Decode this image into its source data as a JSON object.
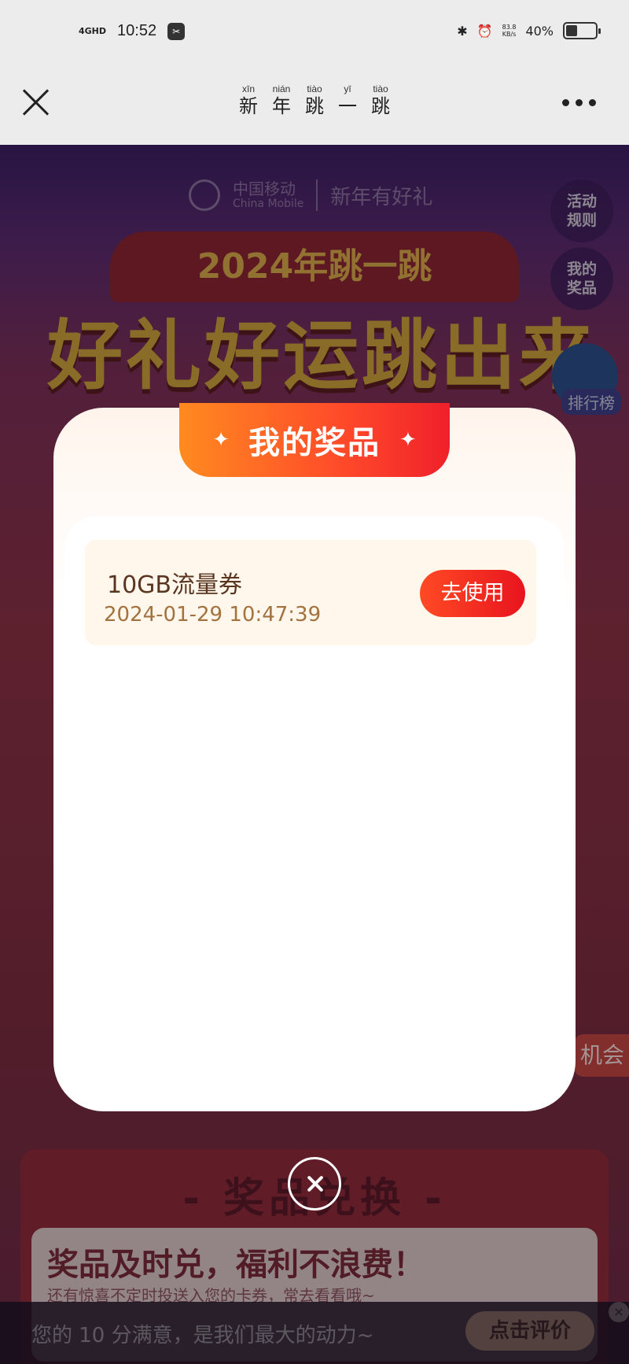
{
  "status_bar": {
    "signal": "4GHD",
    "time": "10:52",
    "net_speed_value": "83.8",
    "net_speed_unit": "KB/s",
    "battery": "40%",
    "battery_level": 0.4
  },
  "nav": {
    "title_chars": [
      {
        "pinyin": "xīn",
        "char": "新"
      },
      {
        "pinyin": "nián",
        "char": "年"
      },
      {
        "pinyin": "tiào",
        "char": "跳"
      },
      {
        "pinyin": "yī",
        "char": "一"
      },
      {
        "pinyin": "tiào",
        "char": "跳"
      }
    ]
  },
  "background": {
    "brand_name": "中国移动",
    "brand_sub": "China Mobile",
    "brand_slogan": "新年有好礼",
    "rules_btn": "活动规则",
    "my_prizes_btn": "我的奖品",
    "year_banner": "2024年跳一跳",
    "main_title": "好礼好运跳出来",
    "rank_label": "排行榜",
    "chance_label": "机会",
    "exchange_title": "- 奖品兑换 -",
    "exchange_heading": "奖品及时兑，福利不浪费！",
    "exchange_desc": "还有惊喜不定时投送入您的卡券，常去看看哦~"
  },
  "modal": {
    "title": "我的奖品",
    "prizes": [
      {
        "name": "10GB流量券",
        "date": "2024-01-29 10:47:39",
        "action": "去使用"
      }
    ]
  },
  "rating_bar": {
    "text": "您的 10 分满意，是我们最大的动力~",
    "button": "点击评价"
  },
  "colors": {
    "accent": "#ff4a2a",
    "header_gradient_start": "#ff8a1f",
    "header_gradient_end": "#f0202a",
    "prize_date": "#a3723f"
  }
}
